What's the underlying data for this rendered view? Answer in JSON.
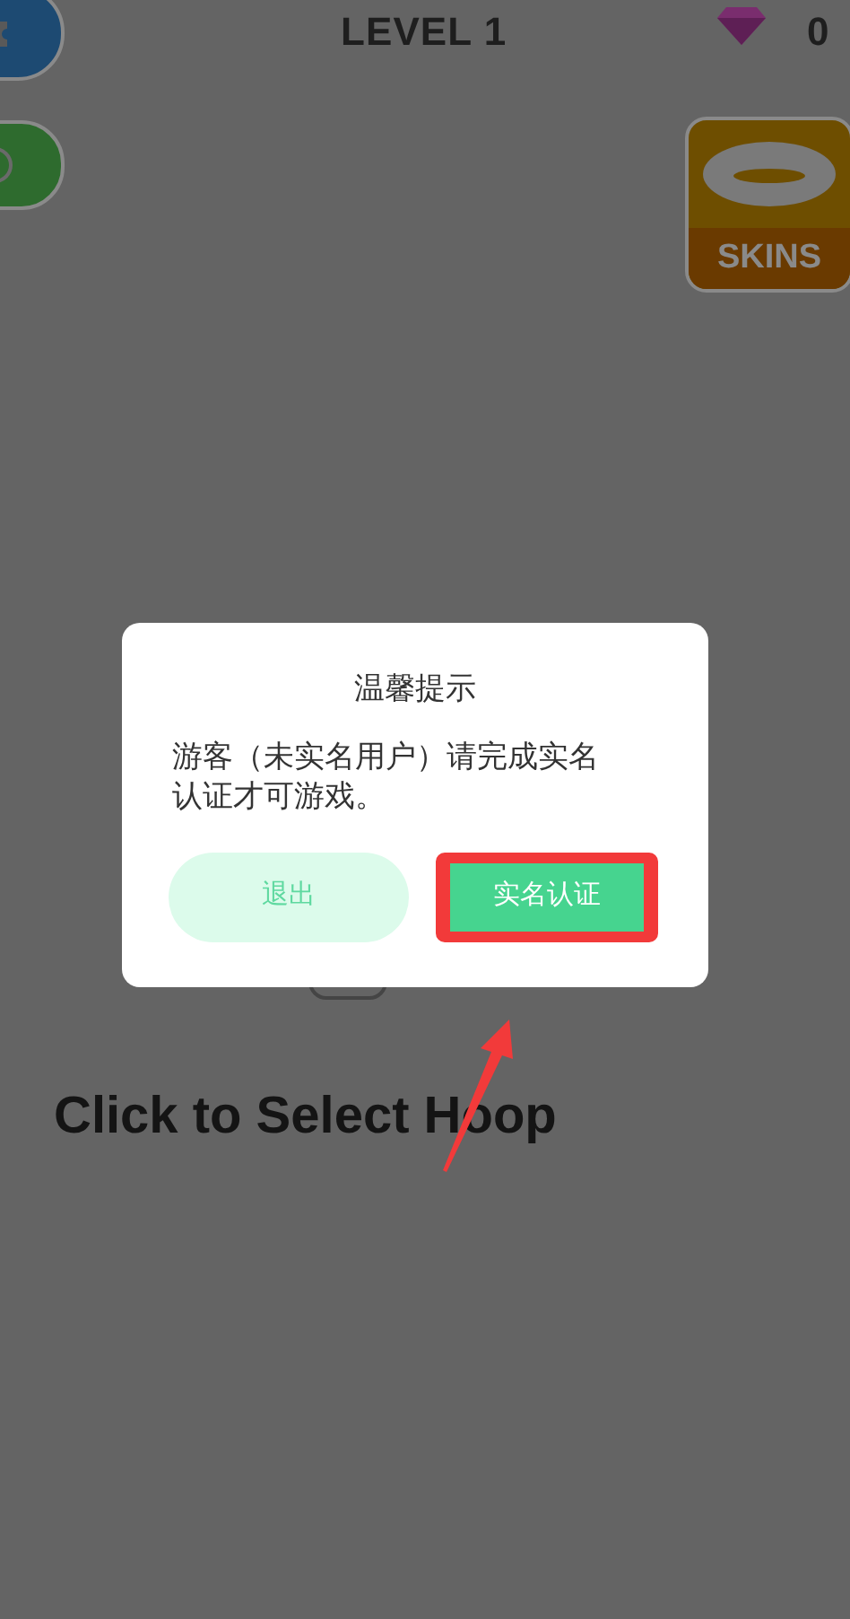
{
  "hud": {
    "level": "LEVEL 1",
    "gems": "0"
  },
  "skins_button": {
    "label": "SKINS"
  },
  "hint": "Click to Select Hoop",
  "dialog": {
    "title": "温馨提示",
    "message": "游客（未实名用户）请完成实名认证才可游戏。",
    "buttons": [
      {
        "label": "退出",
        "kind": "secondary",
        "highlighted": false
      },
      {
        "label": "实名认证",
        "kind": "primary",
        "highlighted": true
      }
    ]
  }
}
